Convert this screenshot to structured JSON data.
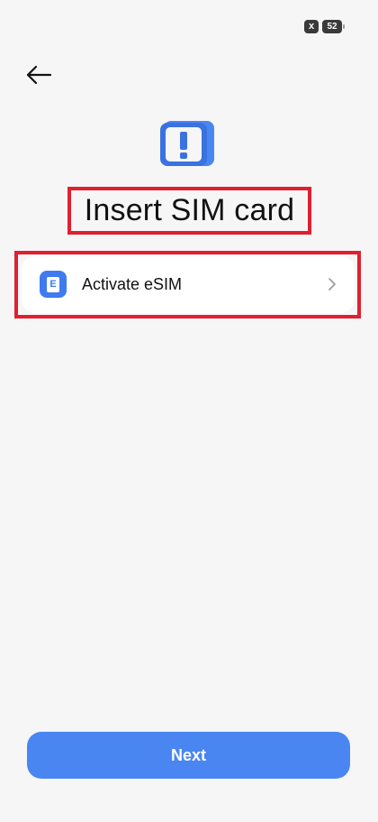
{
  "status_bar": {
    "notification_icon": "x",
    "battery_level": "52"
  },
  "header": {
    "back_icon": "back-arrow-icon"
  },
  "hero": {
    "icon": "sim-alert-icon",
    "title": "Insert SIM card"
  },
  "options": [
    {
      "label": "Activate eSIM",
      "icon": "esim-icon",
      "icon_letter": "E",
      "trailing_icon": "chevron-right-icon"
    }
  ],
  "footer": {
    "next_label": "Next"
  },
  "colors": {
    "accent": "#4a86f2",
    "highlight": "#e0202f",
    "background": "#f6f6f7"
  }
}
